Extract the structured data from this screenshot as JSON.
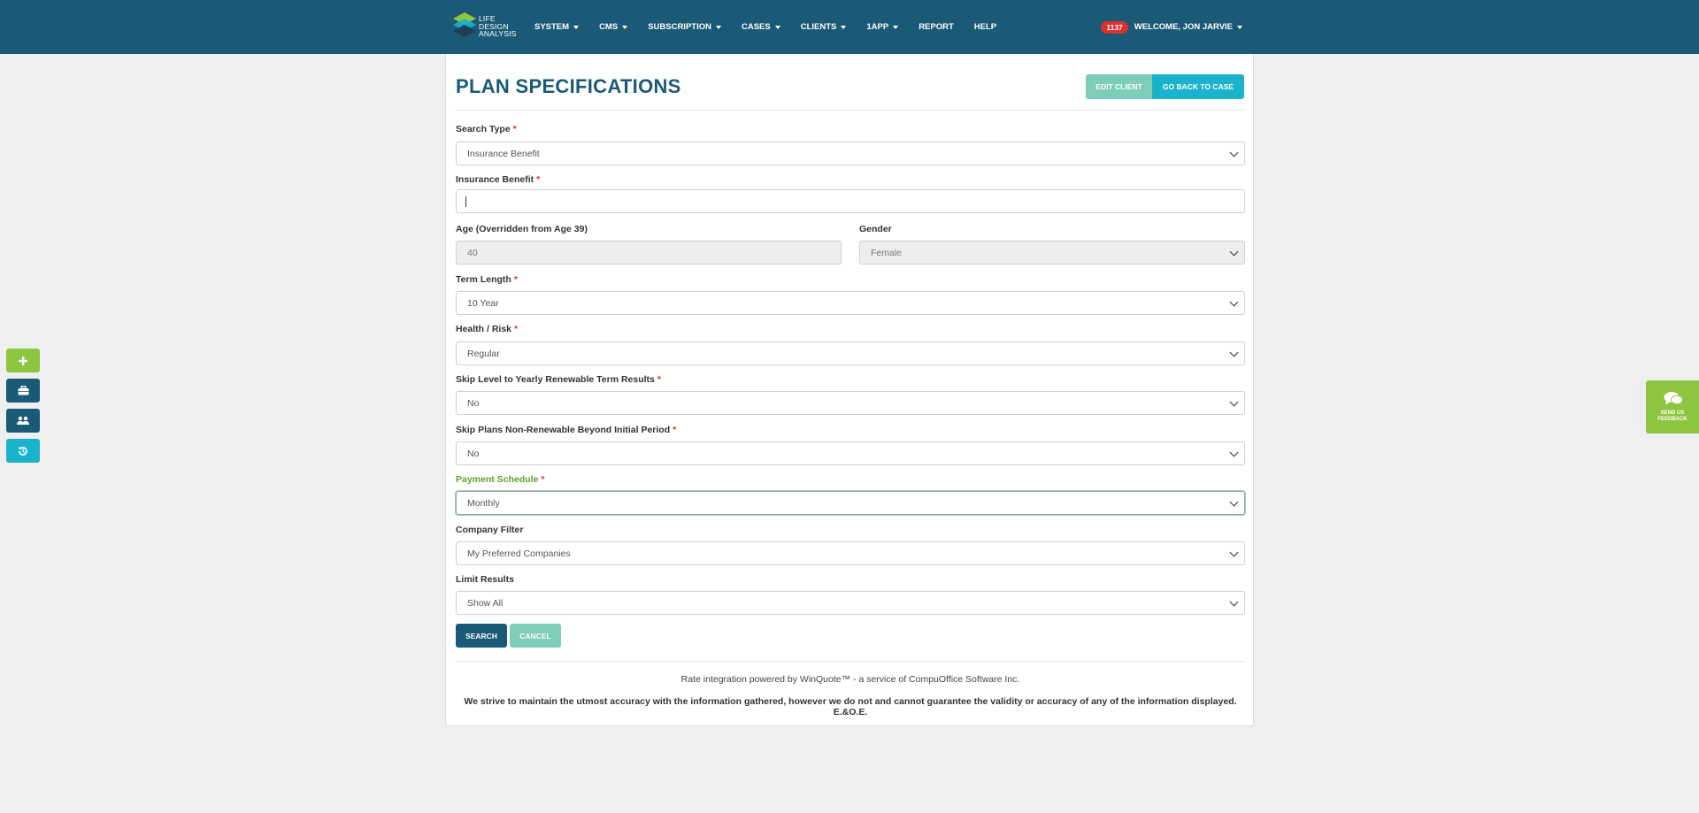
{
  "header": {
    "logo_lines": [
      "LIFE",
      "DESIGN",
      "ANALYSIS"
    ],
    "nav": [
      {
        "label": "SYSTEM",
        "dropdown": true
      },
      {
        "label": "CMS",
        "dropdown": true
      },
      {
        "label": "SUBSCRIPTION",
        "dropdown": true
      },
      {
        "label": "CASES",
        "dropdown": true
      },
      {
        "label": "CLIENTS",
        "dropdown": true
      },
      {
        "label": "1APP",
        "dropdown": true
      },
      {
        "label": "REPORT",
        "dropdown": false
      },
      {
        "label": "HELP",
        "dropdown": false
      }
    ],
    "notification_count": "1137",
    "welcome": "WELCOME, JON JARVIE"
  },
  "page": {
    "title": "PLAN SPECIFICATIONS",
    "edit_client": "EDIT CLIENT",
    "go_back": "GO BACK TO CASE"
  },
  "form": {
    "search_type": {
      "label": "Search Type",
      "value": "Insurance Benefit"
    },
    "insurance_benefit": {
      "label": "Insurance Benefit",
      "value": ""
    },
    "age": {
      "label": "Age (Overridden from Age 39)",
      "value": "40"
    },
    "gender": {
      "label": "Gender",
      "value": "Female"
    },
    "term_length": {
      "label": "Term Length",
      "value": "10 Year"
    },
    "health_risk": {
      "label": "Health / Risk",
      "value": "Regular"
    },
    "skip_level": {
      "label": "Skip Level to Yearly Renewable Term Results",
      "value": "No"
    },
    "skip_plans": {
      "label": "Skip Plans Non-Renewable Beyond Initial Period",
      "value": "No"
    },
    "payment_schedule": {
      "label": "Payment Schedule",
      "value": "Monthly"
    },
    "company_filter": {
      "label": "Company Filter",
      "value": "My Preferred Companies"
    },
    "limit_results": {
      "label": "Limit Results",
      "value": "Show All"
    },
    "required_mark": "*",
    "search_button": "SEARCH",
    "cancel_button": "CANCEL"
  },
  "footer": {
    "rate_line": "Rate integration powered by WinQuote™ - a service of CompuOffice Software Inc.",
    "disclaimer": "We strive to maintain the utmost accuracy with the information gathered, however we do not and cannot guarantee the validity or accuracy of any of the information displayed. E.&O.E."
  },
  "quick_actions": [
    {
      "icon": "plus-icon",
      "color": "#8cc63f"
    },
    {
      "icon": "briefcase-icon",
      "color": "#1b5a77"
    },
    {
      "icon": "users-icon",
      "color": "#1b5a77"
    },
    {
      "icon": "history-icon",
      "color": "#1bb3cc"
    }
  ],
  "feedback": {
    "lines": [
      "SEND US",
      "FEEDBACK"
    ]
  },
  "colors": {
    "header": "#1b5a77",
    "accent_teal": "#1bb3cc",
    "accent_mint": "#7ecdb8",
    "accent_green": "#8cc63f",
    "badge_red": "#d9322f"
  }
}
